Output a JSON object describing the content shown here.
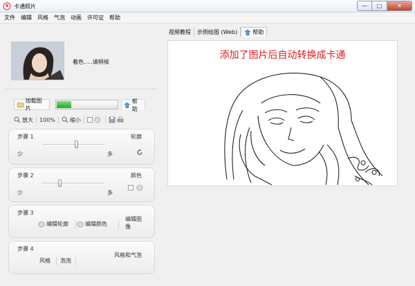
{
  "window": {
    "title": "卡通照片",
    "minimize": "—",
    "maximize": "□",
    "close": "✕",
    "icon": "cartoon-app-icon"
  },
  "menu": [
    "文件",
    "编辑",
    "风格",
    "气泡",
    "动画",
    "许可证",
    "帮助"
  ],
  "tabs": {
    "video_tutorial": "视频教程",
    "example": "示例绘图 (Web)",
    "help": "帮助"
  },
  "canvas": {
    "headline": "添加了图片后自动转换成卡通"
  },
  "photo": {
    "status": "着色.....请稍候"
  },
  "toolbar": {
    "load_image": "加载图片",
    "help": "帮助",
    "progress_percent": 22,
    "zoom_in": "放大",
    "zoom_level": "100%",
    "zoom_out": "缩小"
  },
  "steps": {
    "step1": {
      "title": "步骤 1",
      "right": "轮廓",
      "less": "少",
      "more": "多",
      "slider_value": 0.55
    },
    "step2": {
      "title": "步骤 2",
      "right": "颜色",
      "less": "少",
      "more": "多",
      "slider_value": 0.28
    },
    "step3": {
      "title": "步骤 3",
      "edit_outline": "编辑轮廓",
      "edit_color": "编辑颜色",
      "edit_image": "编辑图像"
    },
    "step4": {
      "title": "步骤 4",
      "style": "风格",
      "bubble": "泡泡",
      "style_bubble": "风格和气泡"
    }
  },
  "colors": {
    "headline": "#e02020",
    "progress": "#21a821"
  }
}
